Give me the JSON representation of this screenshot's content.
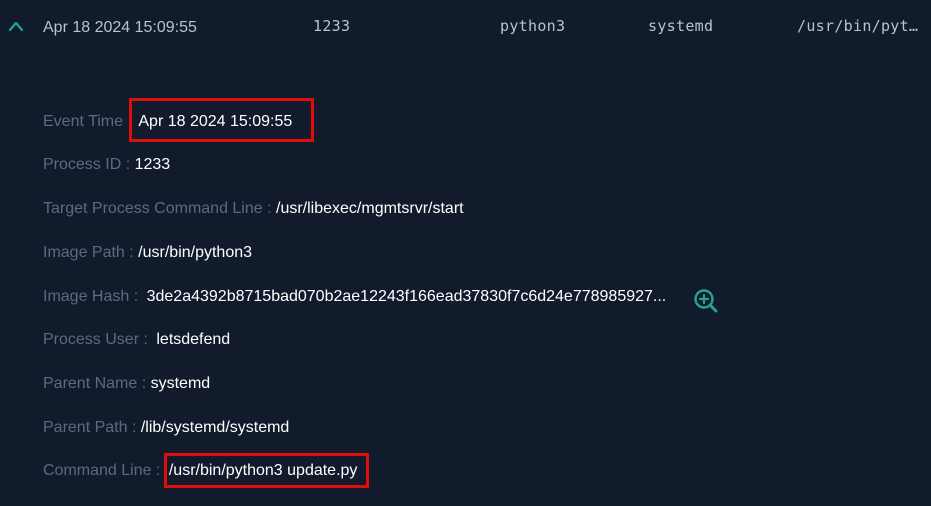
{
  "row": {
    "event_time": "Apr 18 2024 15:09:55",
    "process_id": "1233",
    "image_name": "python3",
    "parent_name": "systemd",
    "image_path": "/usr/bin/pyt…"
  },
  "details": {
    "event_time": {
      "label": "Event Time : ",
      "value": "Apr 18 2024 15:09:55"
    },
    "process_id": {
      "label": "Process ID : ",
      "value": "1233"
    },
    "target_cmd": {
      "label": "Target Process Command Line : ",
      "value": "/usr/libexec/mgmtsrvr/start"
    },
    "image_path": {
      "label": "Image Path : ",
      "value": "/usr/bin/python3"
    },
    "image_hash": {
      "label": "Image Hash : ",
      "value": "3de2a4392b8715bad070b2ae12243f166ead37830f7c6d24e778985927..."
    },
    "process_user": {
      "label": "Process User : ",
      "value": "letsdefend"
    },
    "parent_name": {
      "label": "Parent Name : ",
      "value": "systemd"
    },
    "parent_path": {
      "label": "Parent Path : ",
      "value": "/lib/systemd/systemd"
    },
    "command_line": {
      "label": "Command Line : ",
      "value": "/usr/bin/python3 update.py"
    }
  },
  "icons": {
    "expand": "chevron-up-icon",
    "hash_lookup": "zoom-in-icon"
  },
  "colors": {
    "background": "#111b2c",
    "label": "#5c6b7f",
    "value": "#ffffff",
    "accent": "#1fa58f",
    "highlight": "#e00d0d"
  }
}
